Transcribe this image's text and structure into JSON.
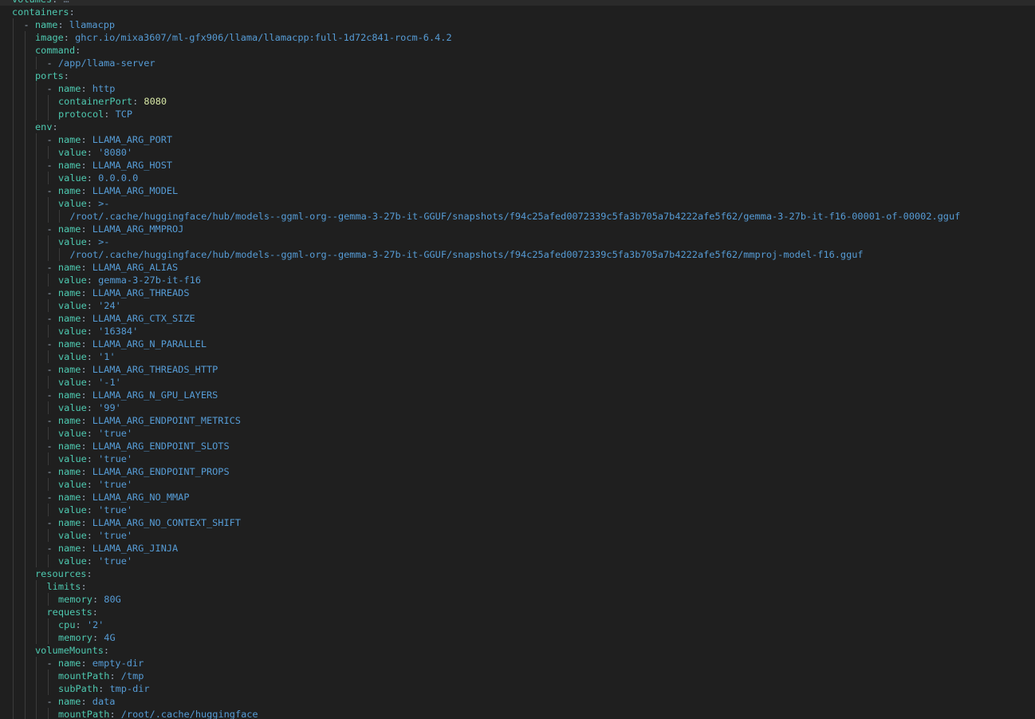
{
  "editor": {
    "language": "yaml",
    "colors": {
      "background": "#1f1f1f",
      "key": "#4ec9b0",
      "string": "#569cd6",
      "number": "#d7e7a6",
      "punctuation": "#9aa8b8",
      "indent_guide": "#3b3b3b"
    },
    "lines": [
      {
        "indent": 0,
        "segments": [
          {
            "t": "volumes",
            "c": "k"
          },
          {
            "t": ": ",
            "c": "p"
          },
          {
            "t": "…",
            "c": "a"
          }
        ]
      },
      {
        "indent": 0,
        "segments": [
          {
            "t": "containers",
            "c": "k"
          },
          {
            "t": ":",
            "c": "p"
          }
        ]
      },
      {
        "indent": 1,
        "segments": [
          {
            "t": "- ",
            "c": "p"
          },
          {
            "t": "name",
            "c": "k"
          },
          {
            "t": ": ",
            "c": "p"
          },
          {
            "t": "llamacpp",
            "c": "s"
          }
        ]
      },
      {
        "indent": 2,
        "segments": [
          {
            "t": "image",
            "c": "k"
          },
          {
            "t": ": ",
            "c": "p"
          },
          {
            "t": "ghcr.io/mixa3607/ml-gfx906/llama/llamacpp:full-1d72c841-rocm-6.4.2",
            "c": "s"
          }
        ]
      },
      {
        "indent": 2,
        "segments": [
          {
            "t": "command",
            "c": "k"
          },
          {
            "t": ":",
            "c": "p"
          }
        ]
      },
      {
        "indent": 3,
        "segments": [
          {
            "t": "- ",
            "c": "p"
          },
          {
            "t": "/app/llama-server",
            "c": "s"
          }
        ]
      },
      {
        "indent": 2,
        "segments": [
          {
            "t": "ports",
            "c": "k"
          },
          {
            "t": ":",
            "c": "p"
          }
        ]
      },
      {
        "indent": 3,
        "segments": [
          {
            "t": "- ",
            "c": "p"
          },
          {
            "t": "name",
            "c": "k"
          },
          {
            "t": ": ",
            "c": "p"
          },
          {
            "t": "http",
            "c": "s"
          }
        ]
      },
      {
        "indent": 4,
        "segments": [
          {
            "t": "containerPort",
            "c": "k"
          },
          {
            "t": ": ",
            "c": "p"
          },
          {
            "t": "8080",
            "c": "n"
          }
        ]
      },
      {
        "indent": 4,
        "segments": [
          {
            "t": "protocol",
            "c": "k"
          },
          {
            "t": ": ",
            "c": "p"
          },
          {
            "t": "TCP",
            "c": "s"
          }
        ]
      },
      {
        "indent": 2,
        "segments": [
          {
            "t": "env",
            "c": "k"
          },
          {
            "t": ":",
            "c": "p"
          }
        ]
      },
      {
        "indent": 3,
        "segments": [
          {
            "t": "- ",
            "c": "p"
          },
          {
            "t": "name",
            "c": "k"
          },
          {
            "t": ": ",
            "c": "p"
          },
          {
            "t": "LLAMA_ARG_PORT",
            "c": "s"
          }
        ]
      },
      {
        "indent": 4,
        "segments": [
          {
            "t": "value",
            "c": "k"
          },
          {
            "t": ": ",
            "c": "p"
          },
          {
            "t": "'8080'",
            "c": "s"
          }
        ]
      },
      {
        "indent": 3,
        "segments": [
          {
            "t": "- ",
            "c": "p"
          },
          {
            "t": "name",
            "c": "k"
          },
          {
            "t": ": ",
            "c": "p"
          },
          {
            "t": "LLAMA_ARG_HOST",
            "c": "s"
          }
        ]
      },
      {
        "indent": 4,
        "segments": [
          {
            "t": "value",
            "c": "k"
          },
          {
            "t": ": ",
            "c": "p"
          },
          {
            "t": "0.0.0.0",
            "c": "s"
          }
        ]
      },
      {
        "indent": 3,
        "segments": [
          {
            "t": "- ",
            "c": "p"
          },
          {
            "t": "name",
            "c": "k"
          },
          {
            "t": ": ",
            "c": "p"
          },
          {
            "t": "LLAMA_ARG_MODEL",
            "c": "s"
          }
        ]
      },
      {
        "indent": 4,
        "segments": [
          {
            "t": "value",
            "c": "k"
          },
          {
            "t": ": ",
            "c": "p"
          },
          {
            "t": ">-",
            "c": "s"
          }
        ]
      },
      {
        "indent": 5,
        "segments": [
          {
            "t": "/root/.cache/huggingface/hub/models--ggml-org--gemma-3-27b-it-GGUF/snapshots/f94c25afed0072339c5fa3b705a7b4222afe5f62/gemma-3-27b-it-f16-00001-of-00002.gguf",
            "c": "s"
          }
        ]
      },
      {
        "indent": 3,
        "segments": [
          {
            "t": "- ",
            "c": "p"
          },
          {
            "t": "name",
            "c": "k"
          },
          {
            "t": ": ",
            "c": "p"
          },
          {
            "t": "LLAMA_ARG_MMPROJ",
            "c": "s"
          }
        ]
      },
      {
        "indent": 4,
        "segments": [
          {
            "t": "value",
            "c": "k"
          },
          {
            "t": ": ",
            "c": "p"
          },
          {
            "t": ">-",
            "c": "s"
          }
        ]
      },
      {
        "indent": 5,
        "segments": [
          {
            "t": "/root/.cache/huggingface/hub/models--ggml-org--gemma-3-27b-it-GGUF/snapshots/f94c25afed0072339c5fa3b705a7b4222afe5f62/mmproj-model-f16.gguf",
            "c": "s"
          }
        ]
      },
      {
        "indent": 3,
        "segments": [
          {
            "t": "- ",
            "c": "p"
          },
          {
            "t": "name",
            "c": "k"
          },
          {
            "t": ": ",
            "c": "p"
          },
          {
            "t": "LLAMA_ARG_ALIAS",
            "c": "s"
          }
        ]
      },
      {
        "indent": 4,
        "segments": [
          {
            "t": "value",
            "c": "k"
          },
          {
            "t": ": ",
            "c": "p"
          },
          {
            "t": "gemma-3-27b-it-f16",
            "c": "s"
          }
        ]
      },
      {
        "indent": 3,
        "segments": [
          {
            "t": "- ",
            "c": "p"
          },
          {
            "t": "name",
            "c": "k"
          },
          {
            "t": ": ",
            "c": "p"
          },
          {
            "t": "LLAMA_ARG_THREADS",
            "c": "s"
          }
        ]
      },
      {
        "indent": 4,
        "segments": [
          {
            "t": "value",
            "c": "k"
          },
          {
            "t": ": ",
            "c": "p"
          },
          {
            "t": "'24'",
            "c": "s"
          }
        ]
      },
      {
        "indent": 3,
        "segments": [
          {
            "t": "- ",
            "c": "p"
          },
          {
            "t": "name",
            "c": "k"
          },
          {
            "t": ": ",
            "c": "p"
          },
          {
            "t": "LLAMA_ARG_CTX_SIZE",
            "c": "s"
          }
        ]
      },
      {
        "indent": 4,
        "segments": [
          {
            "t": "value",
            "c": "k"
          },
          {
            "t": ": ",
            "c": "p"
          },
          {
            "t": "'16384'",
            "c": "s"
          }
        ]
      },
      {
        "indent": 3,
        "segments": [
          {
            "t": "- ",
            "c": "p"
          },
          {
            "t": "name",
            "c": "k"
          },
          {
            "t": ": ",
            "c": "p"
          },
          {
            "t": "LLAMA_ARG_N_PARALLEL",
            "c": "s"
          }
        ]
      },
      {
        "indent": 4,
        "segments": [
          {
            "t": "value",
            "c": "k"
          },
          {
            "t": ": ",
            "c": "p"
          },
          {
            "t": "'1'",
            "c": "s"
          }
        ]
      },
      {
        "indent": 3,
        "segments": [
          {
            "t": "- ",
            "c": "p"
          },
          {
            "t": "name",
            "c": "k"
          },
          {
            "t": ": ",
            "c": "p"
          },
          {
            "t": "LLAMA_ARG_THREADS_HTTP",
            "c": "s"
          }
        ]
      },
      {
        "indent": 4,
        "segments": [
          {
            "t": "value",
            "c": "k"
          },
          {
            "t": ": ",
            "c": "p"
          },
          {
            "t": "'-1'",
            "c": "s"
          }
        ]
      },
      {
        "indent": 3,
        "segments": [
          {
            "t": "- ",
            "c": "p"
          },
          {
            "t": "name",
            "c": "k"
          },
          {
            "t": ": ",
            "c": "p"
          },
          {
            "t": "LLAMA_ARG_N_GPU_LAYERS",
            "c": "s"
          }
        ]
      },
      {
        "indent": 4,
        "segments": [
          {
            "t": "value",
            "c": "k"
          },
          {
            "t": ": ",
            "c": "p"
          },
          {
            "t": "'99'",
            "c": "s"
          }
        ]
      },
      {
        "indent": 3,
        "segments": [
          {
            "t": "- ",
            "c": "p"
          },
          {
            "t": "name",
            "c": "k"
          },
          {
            "t": ": ",
            "c": "p"
          },
          {
            "t": "LLAMA_ARG_ENDPOINT_METRICS",
            "c": "s"
          }
        ]
      },
      {
        "indent": 4,
        "segments": [
          {
            "t": "value",
            "c": "k"
          },
          {
            "t": ": ",
            "c": "p"
          },
          {
            "t": "'true'",
            "c": "s"
          }
        ]
      },
      {
        "indent": 3,
        "segments": [
          {
            "t": "- ",
            "c": "p"
          },
          {
            "t": "name",
            "c": "k"
          },
          {
            "t": ": ",
            "c": "p"
          },
          {
            "t": "LLAMA_ARG_ENDPOINT_SLOTS",
            "c": "s"
          }
        ]
      },
      {
        "indent": 4,
        "segments": [
          {
            "t": "value",
            "c": "k"
          },
          {
            "t": ": ",
            "c": "p"
          },
          {
            "t": "'true'",
            "c": "s"
          }
        ]
      },
      {
        "indent": 3,
        "segments": [
          {
            "t": "- ",
            "c": "p"
          },
          {
            "t": "name",
            "c": "k"
          },
          {
            "t": ": ",
            "c": "p"
          },
          {
            "t": "LLAMA_ARG_ENDPOINT_PROPS",
            "c": "s"
          }
        ]
      },
      {
        "indent": 4,
        "segments": [
          {
            "t": "value",
            "c": "k"
          },
          {
            "t": ": ",
            "c": "p"
          },
          {
            "t": "'true'",
            "c": "s"
          }
        ]
      },
      {
        "indent": 3,
        "segments": [
          {
            "t": "- ",
            "c": "p"
          },
          {
            "t": "name",
            "c": "k"
          },
          {
            "t": ": ",
            "c": "p"
          },
          {
            "t": "LLAMA_ARG_NO_MMAP",
            "c": "s"
          }
        ]
      },
      {
        "indent": 4,
        "segments": [
          {
            "t": "value",
            "c": "k"
          },
          {
            "t": ": ",
            "c": "p"
          },
          {
            "t": "'true'",
            "c": "s"
          }
        ]
      },
      {
        "indent": 3,
        "segments": [
          {
            "t": "- ",
            "c": "p"
          },
          {
            "t": "name",
            "c": "k"
          },
          {
            "t": ": ",
            "c": "p"
          },
          {
            "t": "LLAMA_ARG_NO_CONTEXT_SHIFT",
            "c": "s"
          }
        ]
      },
      {
        "indent": 4,
        "segments": [
          {
            "t": "value",
            "c": "k"
          },
          {
            "t": ": ",
            "c": "p"
          },
          {
            "t": "'true'",
            "c": "s"
          }
        ]
      },
      {
        "indent": 3,
        "segments": [
          {
            "t": "- ",
            "c": "p"
          },
          {
            "t": "name",
            "c": "k"
          },
          {
            "t": ": ",
            "c": "p"
          },
          {
            "t": "LLAMA_ARG_JINJA",
            "c": "s"
          }
        ]
      },
      {
        "indent": 4,
        "segments": [
          {
            "t": "value",
            "c": "k"
          },
          {
            "t": ": ",
            "c": "p"
          },
          {
            "t": "'true'",
            "c": "s"
          }
        ]
      },
      {
        "indent": 2,
        "segments": [
          {
            "t": "resources",
            "c": "k"
          },
          {
            "t": ":",
            "c": "p"
          }
        ]
      },
      {
        "indent": 3,
        "segments": [
          {
            "t": "limits",
            "c": "k"
          },
          {
            "t": ":",
            "c": "p"
          }
        ]
      },
      {
        "indent": 4,
        "segments": [
          {
            "t": "memory",
            "c": "k"
          },
          {
            "t": ": ",
            "c": "p"
          },
          {
            "t": "80G",
            "c": "s"
          }
        ]
      },
      {
        "indent": 3,
        "segments": [
          {
            "t": "requests",
            "c": "k"
          },
          {
            "t": ":",
            "c": "p"
          }
        ]
      },
      {
        "indent": 4,
        "segments": [
          {
            "t": "cpu",
            "c": "k"
          },
          {
            "t": ": ",
            "c": "p"
          },
          {
            "t": "'2'",
            "c": "s"
          }
        ]
      },
      {
        "indent": 4,
        "segments": [
          {
            "t": "memory",
            "c": "k"
          },
          {
            "t": ": ",
            "c": "p"
          },
          {
            "t": "4G",
            "c": "s"
          }
        ]
      },
      {
        "indent": 2,
        "segments": [
          {
            "t": "volumeMounts",
            "c": "k"
          },
          {
            "t": ":",
            "c": "p"
          }
        ]
      },
      {
        "indent": 3,
        "segments": [
          {
            "t": "- ",
            "c": "p"
          },
          {
            "t": "name",
            "c": "k"
          },
          {
            "t": ": ",
            "c": "p"
          },
          {
            "t": "empty-dir",
            "c": "s"
          }
        ]
      },
      {
        "indent": 4,
        "segments": [
          {
            "t": "mountPath",
            "c": "k"
          },
          {
            "t": ": ",
            "c": "p"
          },
          {
            "t": "/tmp",
            "c": "s"
          }
        ]
      },
      {
        "indent": 4,
        "segments": [
          {
            "t": "subPath",
            "c": "k"
          },
          {
            "t": ": ",
            "c": "p"
          },
          {
            "t": "tmp-dir",
            "c": "s"
          }
        ]
      },
      {
        "indent": 3,
        "segments": [
          {
            "t": "- ",
            "c": "p"
          },
          {
            "t": "name",
            "c": "k"
          },
          {
            "t": ": ",
            "c": "p"
          },
          {
            "t": "data",
            "c": "s"
          }
        ]
      },
      {
        "indent": 4,
        "segments": [
          {
            "t": "mountPath",
            "c": "k"
          },
          {
            "t": ": ",
            "c": "p"
          },
          {
            "t": "/root/.cache/huggingface",
            "c": "s"
          }
        ]
      }
    ]
  }
}
